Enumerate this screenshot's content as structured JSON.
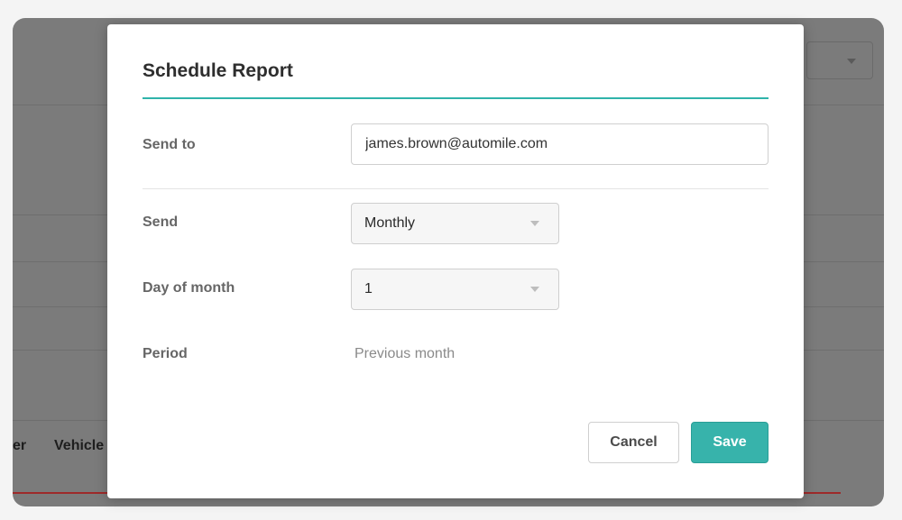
{
  "background": {
    "columns": [
      "er",
      "Vehicle"
    ]
  },
  "dialog": {
    "title": "Schedule Report",
    "accent_color": "#2fb3aa",
    "send_to": {
      "label": "Send to",
      "value": "james.brown@automile.com"
    },
    "send": {
      "label": "Send",
      "value": "Monthly"
    },
    "day_of_month": {
      "label": "Day of month",
      "value": "1"
    },
    "period": {
      "label": "Period",
      "value": "Previous month"
    },
    "buttons": {
      "cancel": "Cancel",
      "save": "Save",
      "save_color": "#37b3ab"
    }
  },
  "icons": {
    "dropdown": "chevron-down-icon"
  }
}
